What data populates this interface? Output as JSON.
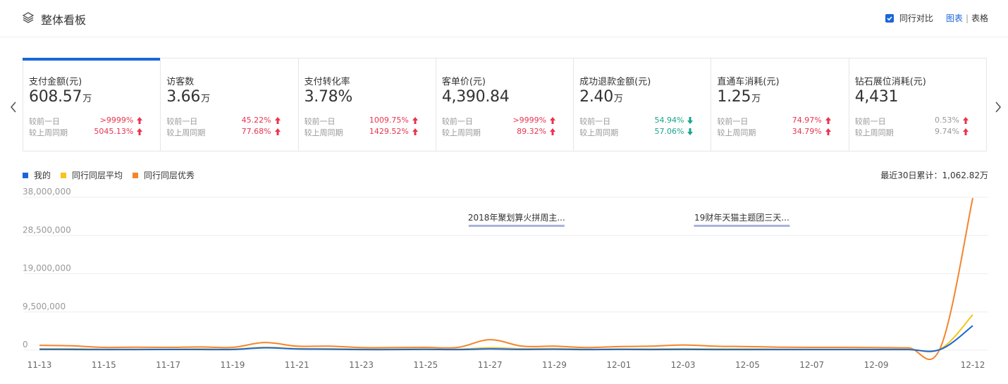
{
  "header": {
    "title": "整体看板",
    "compare_label": "同行对比",
    "compare_checked": true,
    "view_chart": "图表",
    "view_sep": "|",
    "view_table": "表格"
  },
  "cards": [
    {
      "label": "支付金额(元)",
      "value": "608.57",
      "unit": "万",
      "day_label": "较前一日",
      "day_value": ">9999%",
      "day_dir": "up",
      "week_label": "较上周同期",
      "week_value": "5045.13%",
      "week_dir": "up"
    },
    {
      "label": "访客数",
      "value": "3.66",
      "unit": "万",
      "day_label": "较前一日",
      "day_value": "45.22%",
      "day_dir": "up",
      "week_label": "较上周同期",
      "week_value": "77.68%",
      "week_dir": "up"
    },
    {
      "label": "支付转化率",
      "value": "3.78%",
      "unit": "",
      "day_label": "较前一日",
      "day_value": "1009.75%",
      "day_dir": "up",
      "week_label": "较上周同期",
      "week_value": "1429.52%",
      "week_dir": "up"
    },
    {
      "label": "客单价(元)",
      "value": "4,390.84",
      "unit": "",
      "day_label": "较前一日",
      "day_value": ">9999%",
      "day_dir": "up",
      "week_label": "较上周同期",
      "week_value": "89.32%",
      "week_dir": "up"
    },
    {
      "label": "成功退款金额(元)",
      "value": "2.40",
      "unit": "万",
      "day_label": "较前一日",
      "day_value": "54.94%",
      "day_dir": "down",
      "week_label": "较上周同期",
      "week_value": "57.06%",
      "week_dir": "down"
    },
    {
      "label": "直通车消耗(元)",
      "value": "1.25",
      "unit": "万",
      "day_label": "较前一日",
      "day_value": "74.97%",
      "day_dir": "up",
      "week_label": "较上周同期",
      "week_value": "34.79%",
      "week_dir": "up"
    },
    {
      "label": "钻石展位消耗(元)",
      "value": "4,431",
      "unit": "",
      "day_label": "较前一日",
      "day_value": "0.53%",
      "day_dir": "neutral-up",
      "week_label": "较上周同期",
      "week_value": "9.74%",
      "week_dir": "neutral-up"
    }
  ],
  "legend": [
    {
      "name": "我的",
      "color": "#1a66d9"
    },
    {
      "name": "同行同层平均",
      "color": "#f5c518"
    },
    {
      "name": "同行同层优秀",
      "color": "#f5842c"
    }
  ],
  "total_text": "最近30日累计：1,062.82万",
  "colors": {
    "accent": "#1a66d9",
    "up": "#e8344e",
    "down": "#18a58c"
  },
  "chart_data": {
    "type": "line",
    "x": [
      "11-13",
      "11-14",
      "11-15",
      "11-16",
      "11-17",
      "11-18",
      "11-19",
      "11-20",
      "11-21",
      "11-22",
      "11-23",
      "11-24",
      "11-25",
      "11-26",
      "11-27",
      "11-28",
      "11-29",
      "11-30",
      "12-01",
      "12-02",
      "12-03",
      "12-04",
      "12-05",
      "12-06",
      "12-07",
      "12-08",
      "12-09",
      "12-10",
      "12-11",
      "12-12"
    ],
    "x_tick_labels": [
      "11-13",
      "11-15",
      "11-17",
      "11-19",
      "11-21",
      "11-23",
      "11-25",
      "11-27",
      "11-29",
      "12-01",
      "12-03",
      "12-05",
      "12-07",
      "12-09",
      "12-12"
    ],
    "y_ticks": [
      "0",
      "9,500,000",
      "19,000,000",
      "28,500,000",
      "38,000,000"
    ],
    "ylim": [
      0,
      38000000
    ],
    "series": [
      {
        "name": "我的",
        "values": [
          200000,
          180000,
          150000,
          160000,
          170000,
          180000,
          170000,
          600000,
          300000,
          250000,
          150000,
          150000,
          200000,
          150000,
          300000,
          200000,
          250000,
          150000,
          200000,
          150000,
          200000,
          150000,
          150000,
          150000,
          150000,
          150000,
          150000,
          150000,
          200000,
          6080000
        ]
      },
      {
        "name": "同行同层平均",
        "values": [
          350000,
          350000,
          250000,
          250000,
          250000,
          300000,
          250000,
          700000,
          400000,
          350000,
          250000,
          250000,
          300000,
          250000,
          600000,
          350000,
          400000,
          250000,
          300000,
          300000,
          350000,
          300000,
          300000,
          250000,
          250000,
          250000,
          250000,
          250000,
          300000,
          8800000
        ]
      },
      {
        "name": "同行同层优秀",
        "values": [
          1200000,
          1100000,
          700000,
          750000,
          700000,
          800000,
          700000,
          1900000,
          1000000,
          1000000,
          650000,
          650000,
          700000,
          700000,
          2600000,
          1000000,
          1000000,
          650000,
          900000,
          1000000,
          1300000,
          1000000,
          900000,
          750000,
          700000,
          700000,
          650000,
          600000,
          700000,
          37800000
        ]
      }
    ],
    "annotations": [
      {
        "text": "2018年聚划算火拼周主...",
        "x": "11-28"
      },
      {
        "text": "19财年天猫主题团三天...",
        "x": "12-05"
      }
    ]
  }
}
